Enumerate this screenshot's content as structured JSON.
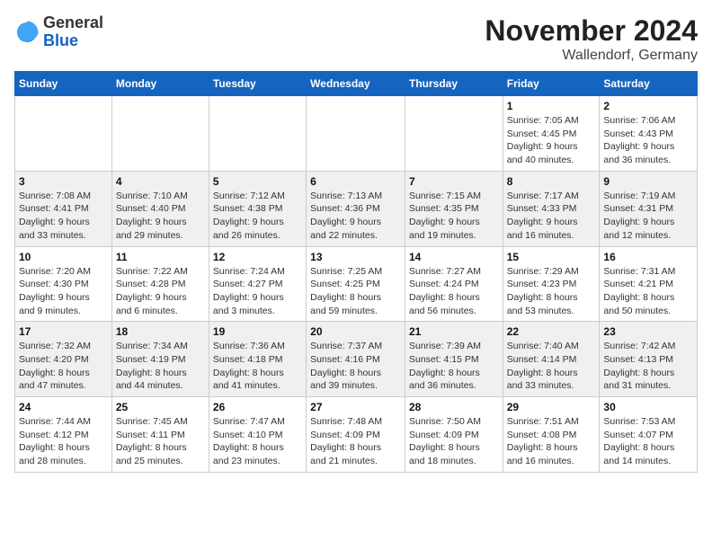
{
  "header": {
    "logo_general": "General",
    "logo_blue": "Blue",
    "month_title": "November 2024",
    "location": "Wallendorf, Germany"
  },
  "weekdays": [
    "Sunday",
    "Monday",
    "Tuesday",
    "Wednesday",
    "Thursday",
    "Friday",
    "Saturday"
  ],
  "weeks": [
    [
      {
        "day": "",
        "info": ""
      },
      {
        "day": "",
        "info": ""
      },
      {
        "day": "",
        "info": ""
      },
      {
        "day": "",
        "info": ""
      },
      {
        "day": "",
        "info": ""
      },
      {
        "day": "1",
        "info": "Sunrise: 7:05 AM\nSunset: 4:45 PM\nDaylight: 9 hours\nand 40 minutes."
      },
      {
        "day": "2",
        "info": "Sunrise: 7:06 AM\nSunset: 4:43 PM\nDaylight: 9 hours\nand 36 minutes."
      }
    ],
    [
      {
        "day": "3",
        "info": "Sunrise: 7:08 AM\nSunset: 4:41 PM\nDaylight: 9 hours\nand 33 minutes."
      },
      {
        "day": "4",
        "info": "Sunrise: 7:10 AM\nSunset: 4:40 PM\nDaylight: 9 hours\nand 29 minutes."
      },
      {
        "day": "5",
        "info": "Sunrise: 7:12 AM\nSunset: 4:38 PM\nDaylight: 9 hours\nand 26 minutes."
      },
      {
        "day": "6",
        "info": "Sunrise: 7:13 AM\nSunset: 4:36 PM\nDaylight: 9 hours\nand 22 minutes."
      },
      {
        "day": "7",
        "info": "Sunrise: 7:15 AM\nSunset: 4:35 PM\nDaylight: 9 hours\nand 19 minutes."
      },
      {
        "day": "8",
        "info": "Sunrise: 7:17 AM\nSunset: 4:33 PM\nDaylight: 9 hours\nand 16 minutes."
      },
      {
        "day": "9",
        "info": "Sunrise: 7:19 AM\nSunset: 4:31 PM\nDaylight: 9 hours\nand 12 minutes."
      }
    ],
    [
      {
        "day": "10",
        "info": "Sunrise: 7:20 AM\nSunset: 4:30 PM\nDaylight: 9 hours\nand 9 minutes."
      },
      {
        "day": "11",
        "info": "Sunrise: 7:22 AM\nSunset: 4:28 PM\nDaylight: 9 hours\nand 6 minutes."
      },
      {
        "day": "12",
        "info": "Sunrise: 7:24 AM\nSunset: 4:27 PM\nDaylight: 9 hours\nand 3 minutes."
      },
      {
        "day": "13",
        "info": "Sunrise: 7:25 AM\nSunset: 4:25 PM\nDaylight: 8 hours\nand 59 minutes."
      },
      {
        "day": "14",
        "info": "Sunrise: 7:27 AM\nSunset: 4:24 PM\nDaylight: 8 hours\nand 56 minutes."
      },
      {
        "day": "15",
        "info": "Sunrise: 7:29 AM\nSunset: 4:23 PM\nDaylight: 8 hours\nand 53 minutes."
      },
      {
        "day": "16",
        "info": "Sunrise: 7:31 AM\nSunset: 4:21 PM\nDaylight: 8 hours\nand 50 minutes."
      }
    ],
    [
      {
        "day": "17",
        "info": "Sunrise: 7:32 AM\nSunset: 4:20 PM\nDaylight: 8 hours\nand 47 minutes."
      },
      {
        "day": "18",
        "info": "Sunrise: 7:34 AM\nSunset: 4:19 PM\nDaylight: 8 hours\nand 44 minutes."
      },
      {
        "day": "19",
        "info": "Sunrise: 7:36 AM\nSunset: 4:18 PM\nDaylight: 8 hours\nand 41 minutes."
      },
      {
        "day": "20",
        "info": "Sunrise: 7:37 AM\nSunset: 4:16 PM\nDaylight: 8 hours\nand 39 minutes."
      },
      {
        "day": "21",
        "info": "Sunrise: 7:39 AM\nSunset: 4:15 PM\nDaylight: 8 hours\nand 36 minutes."
      },
      {
        "day": "22",
        "info": "Sunrise: 7:40 AM\nSunset: 4:14 PM\nDaylight: 8 hours\nand 33 minutes."
      },
      {
        "day": "23",
        "info": "Sunrise: 7:42 AM\nSunset: 4:13 PM\nDaylight: 8 hours\nand 31 minutes."
      }
    ],
    [
      {
        "day": "24",
        "info": "Sunrise: 7:44 AM\nSunset: 4:12 PM\nDaylight: 8 hours\nand 28 minutes."
      },
      {
        "day": "25",
        "info": "Sunrise: 7:45 AM\nSunset: 4:11 PM\nDaylight: 8 hours\nand 25 minutes."
      },
      {
        "day": "26",
        "info": "Sunrise: 7:47 AM\nSunset: 4:10 PM\nDaylight: 8 hours\nand 23 minutes."
      },
      {
        "day": "27",
        "info": "Sunrise: 7:48 AM\nSunset: 4:09 PM\nDaylight: 8 hours\nand 21 minutes."
      },
      {
        "day": "28",
        "info": "Sunrise: 7:50 AM\nSunset: 4:09 PM\nDaylight: 8 hours\nand 18 minutes."
      },
      {
        "day": "29",
        "info": "Sunrise: 7:51 AM\nSunset: 4:08 PM\nDaylight: 8 hours\nand 16 minutes."
      },
      {
        "day": "30",
        "info": "Sunrise: 7:53 AM\nSunset: 4:07 PM\nDaylight: 8 hours\nand 14 minutes."
      }
    ]
  ]
}
